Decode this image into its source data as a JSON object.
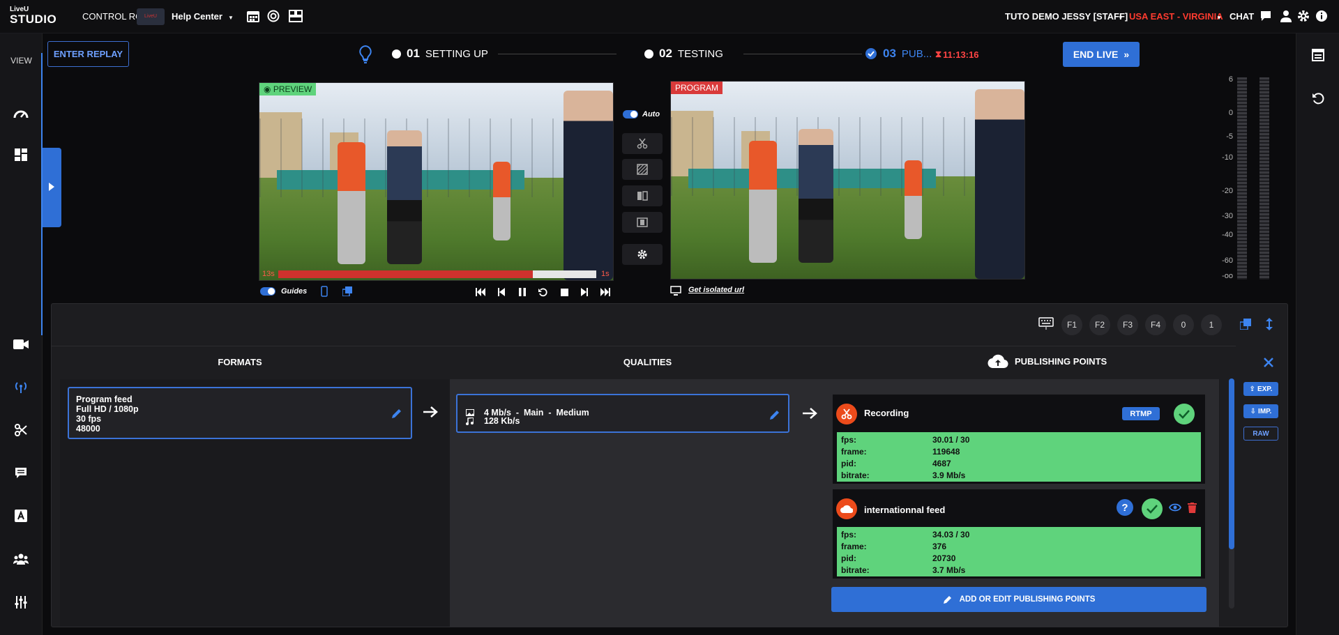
{
  "app": {
    "logo_top": "LiveU",
    "logo_bottom": "STUDIO",
    "control_rooms": "CONTROL ROOMS",
    "help_logo_text": "LiveU",
    "help_center": "Help Center"
  },
  "top_right": {
    "user": "TUTO DEMO JESSY [STAFF]",
    "region": "USA EAST - VIRGINIA",
    "chat": "CHAT"
  },
  "sidebar": {
    "view_label": "VIEW"
  },
  "actions": {
    "enter_replay": "ENTER REPLAY",
    "end_live": "END LIVE"
  },
  "steps": [
    {
      "num": "01",
      "label": "SETTING UP"
    },
    {
      "num": "02",
      "label": "TESTING"
    },
    {
      "num": "03",
      "label": "PUB..."
    }
  ],
  "timer": "11:13:16",
  "preview": {
    "tag": "PREVIEW",
    "left_time": "13s",
    "right_time": "1s",
    "progress": 0.8
  },
  "program": {
    "tag": "PROGRAM"
  },
  "switcher": {
    "auto_label": "Auto"
  },
  "guides_label": "Guides",
  "isolated_url": "Get isolated url",
  "vu_scale": [
    "6",
    "0",
    "-5",
    "-10",
    "-20",
    "-30",
    "-40",
    "-60",
    "-oo"
  ],
  "fkeys": [
    "F1",
    "F2",
    "F3",
    "F4",
    "0",
    "1"
  ],
  "columns": {
    "formats": "FORMATS",
    "qualities": "QUALITIES",
    "publishing": "PUBLISHING POINTS"
  },
  "format_card": {
    "line1": "Program feed",
    "line2": "Full HD / 1080p",
    "line3": "30 fps",
    "line4": "48000"
  },
  "quality_card": {
    "video": "4 Mb/s  -  Main  -  Medium",
    "audio": "128 Kb/s"
  },
  "publishing_points": [
    {
      "name": "Recording",
      "badge": "RTMP",
      "stats": {
        "fps_label": "fps:",
        "fps": "30.01 / 30",
        "frame_label": "frame:",
        "frame": "119648",
        "pid_label": "pid:",
        "pid": "4687",
        "bitrate_label": "bitrate:",
        "bitrate": "3.9 Mb/s"
      }
    },
    {
      "name": "internationnal feed",
      "stats": {
        "fps_label": "fps:",
        "fps": "34.03 / 30",
        "frame_label": "frame:",
        "frame": "376",
        "pid_label": "pid:",
        "pid": "20730",
        "bitrate_label": "bitrate:",
        "bitrate": "3.7 Mb/s"
      }
    }
  ],
  "add_edit_pp": "ADD OR EDIT PUBLISHING POINTS",
  "side_buttons": {
    "exp": "EXP.",
    "imp": "IMP.",
    "raw": "RAW"
  },
  "colors": {
    "accent": "#2f6fd6",
    "region": "#ff3b2f",
    "timer": "#ff4444",
    "stats_bg": "#5fd37c",
    "pp_icon": "#ec4b1b"
  }
}
